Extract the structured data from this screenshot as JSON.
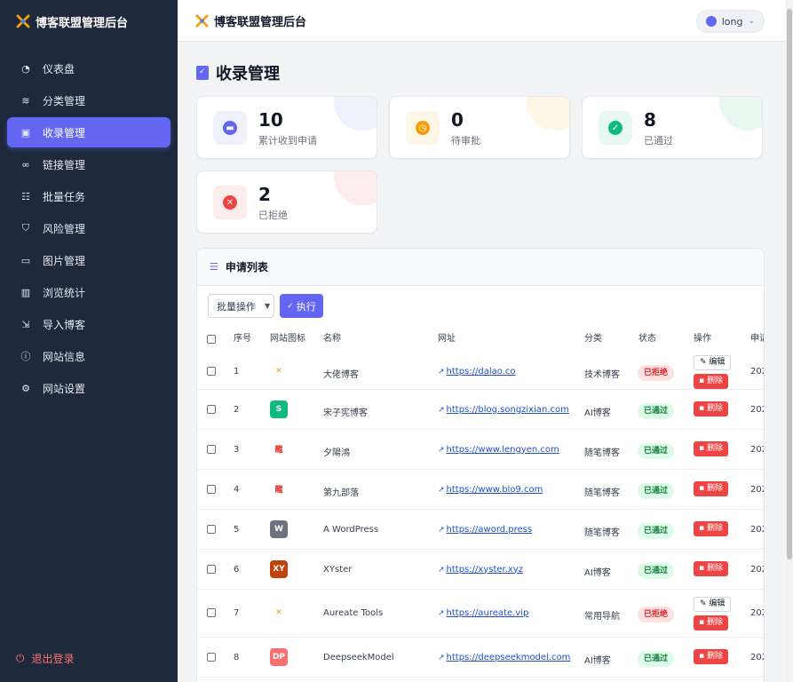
{
  "app": {
    "brand": "博客联盟管理后台"
  },
  "sidebar": {
    "items": [
      {
        "label": "仪表盘",
        "icon": "dashboard-icon",
        "active": false
      },
      {
        "label": "分类管理",
        "icon": "layers-icon",
        "active": false
      },
      {
        "label": "收录管理",
        "icon": "clipboard-check-icon",
        "active": true
      },
      {
        "label": "链接管理",
        "icon": "link-icon",
        "active": false
      },
      {
        "label": "批量任务",
        "icon": "tasks-icon",
        "active": false
      },
      {
        "label": "风险管理",
        "icon": "shield-icon",
        "active": false
      },
      {
        "label": "图片管理",
        "icon": "image-icon",
        "active": false
      },
      {
        "label": "浏览统计",
        "icon": "chart-icon",
        "active": false
      },
      {
        "label": "导入博客",
        "icon": "import-icon",
        "active": false
      },
      {
        "label": "网站信息",
        "icon": "info-icon",
        "active": false
      },
      {
        "label": "网站设置",
        "icon": "gear-icon",
        "active": false
      }
    ],
    "logout": "退出登录"
  },
  "topbar": {
    "title": "博客联盟管理后台",
    "user": "long"
  },
  "page": {
    "title": "收录管理"
  },
  "stats": [
    {
      "value": "10",
      "label": "累计收到申请",
      "color": "#6366f1",
      "bg": "#eef0fb"
    },
    {
      "value": "0",
      "label": "待审批",
      "color": "#f59e0b",
      "bg": "#fef6e7"
    },
    {
      "value": "8",
      "label": "已通过",
      "color": "#10b981",
      "bg": "#e8f8f1"
    },
    {
      "value": "2",
      "label": "已拒绝",
      "color": "#ef4444",
      "bg": "#fdecec"
    }
  ],
  "list": {
    "title": "申请列表",
    "batch_label": "批量操作",
    "exec_label": "执行",
    "headers": [
      "序号",
      "网站图标",
      "名称",
      "网址",
      "分类",
      "状态",
      "操作",
      "申请"
    ],
    "edit_label": "编辑",
    "delete_label": "删除",
    "rows": [
      {
        "no": "1",
        "name": "大佬博客",
        "url": "https://dalao.co",
        "category": "技术博客",
        "status": "已拒绝",
        "date": "202",
        "editable": true
      },
      {
        "no": "2",
        "name": "宋子宪博客",
        "url": "https://blog.songzixian.com",
        "category": "AI博客",
        "status": "已通过",
        "date": "202",
        "editable": false
      },
      {
        "no": "3",
        "name": "夕陽鴻",
        "url": "https://www.lengyen.com",
        "category": "随笔博客",
        "status": "已通过",
        "date": "202",
        "editable": false
      },
      {
        "no": "4",
        "name": "第九部落",
        "url": "https://www.blo9.com",
        "category": "随笔博客",
        "status": "已通过",
        "date": "202",
        "editable": false
      },
      {
        "no": "5",
        "name": "A WordPress",
        "url": "https://aword.press",
        "category": "随笔博客",
        "status": "已通过",
        "date": "202",
        "editable": false
      },
      {
        "no": "6",
        "name": "XYster",
        "url": "https://xyster.xyz",
        "category": "AI博客",
        "status": "已通过",
        "date": "202",
        "editable": false
      },
      {
        "no": "7",
        "name": "Aureate Tools",
        "url": "https://aureate.vip",
        "category": "常用导航",
        "status": "已拒绝",
        "date": "202",
        "editable": true
      },
      {
        "no": "8",
        "name": "DeepseekModel",
        "url": "https://deepseekmodel.com",
        "category": "AI博客",
        "status": "已通过",
        "date": "202",
        "editable": false
      }
    ]
  }
}
